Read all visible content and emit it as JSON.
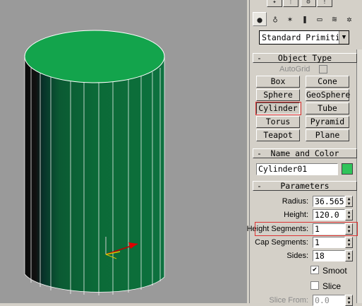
{
  "command_panel": {
    "tabs": [
      "✦",
      "ᛉ",
      "⚙",
      "ǃ"
    ],
    "icons": [
      {
        "name": "geometry-icon",
        "glyph": "●"
      },
      {
        "name": "shapes-icon",
        "glyph": "♁"
      },
      {
        "name": "lights-icon",
        "glyph": "✶"
      },
      {
        "name": "cameras-icon",
        "glyph": "❚"
      },
      {
        "name": "helpers-icon",
        "glyph": "▭"
      },
      {
        "name": "space-warps-icon",
        "glyph": "≋"
      },
      {
        "name": "systems-icon",
        "glyph": "✲"
      }
    ],
    "category_dropdown": "Standard Primitiv"
  },
  "object_type": {
    "title": "Object Type",
    "autogrid_label": "AutoGrid",
    "buttons": [
      "Box",
      "Cone",
      "Sphere",
      "GeoSphere",
      "Cylinder",
      "Tube",
      "Torus",
      "Pyramid",
      "Teapot",
      "Plane"
    ],
    "selected": "Cylinder"
  },
  "name_color": {
    "title": "Name and Color",
    "name_value": "Cylinder01",
    "color": "#2fc45a"
  },
  "parameters": {
    "title": "Parameters",
    "radius_label": "Radius:",
    "radius_value": "36.565",
    "height_label": "Height:",
    "height_value": "120.0",
    "height_segments_label": "Height Segments:",
    "height_segments_value": "1",
    "cap_segments_label": "Cap Segments:",
    "cap_segments_value": "1",
    "sides_label": "Sides:",
    "sides_value": "18",
    "smooth_label": "Smoot",
    "smooth_checked": true,
    "slice_label": "Slice",
    "slice_checked": false,
    "slice_from_label": "Slice From:",
    "slice_from_value": "0.0"
  },
  "colors": {
    "viewport_bg": "#9a9a9a",
    "cylinder_top": "#13a44c",
    "cylinder_side": "#0b6a3a",
    "highlight": "#dd3333"
  }
}
